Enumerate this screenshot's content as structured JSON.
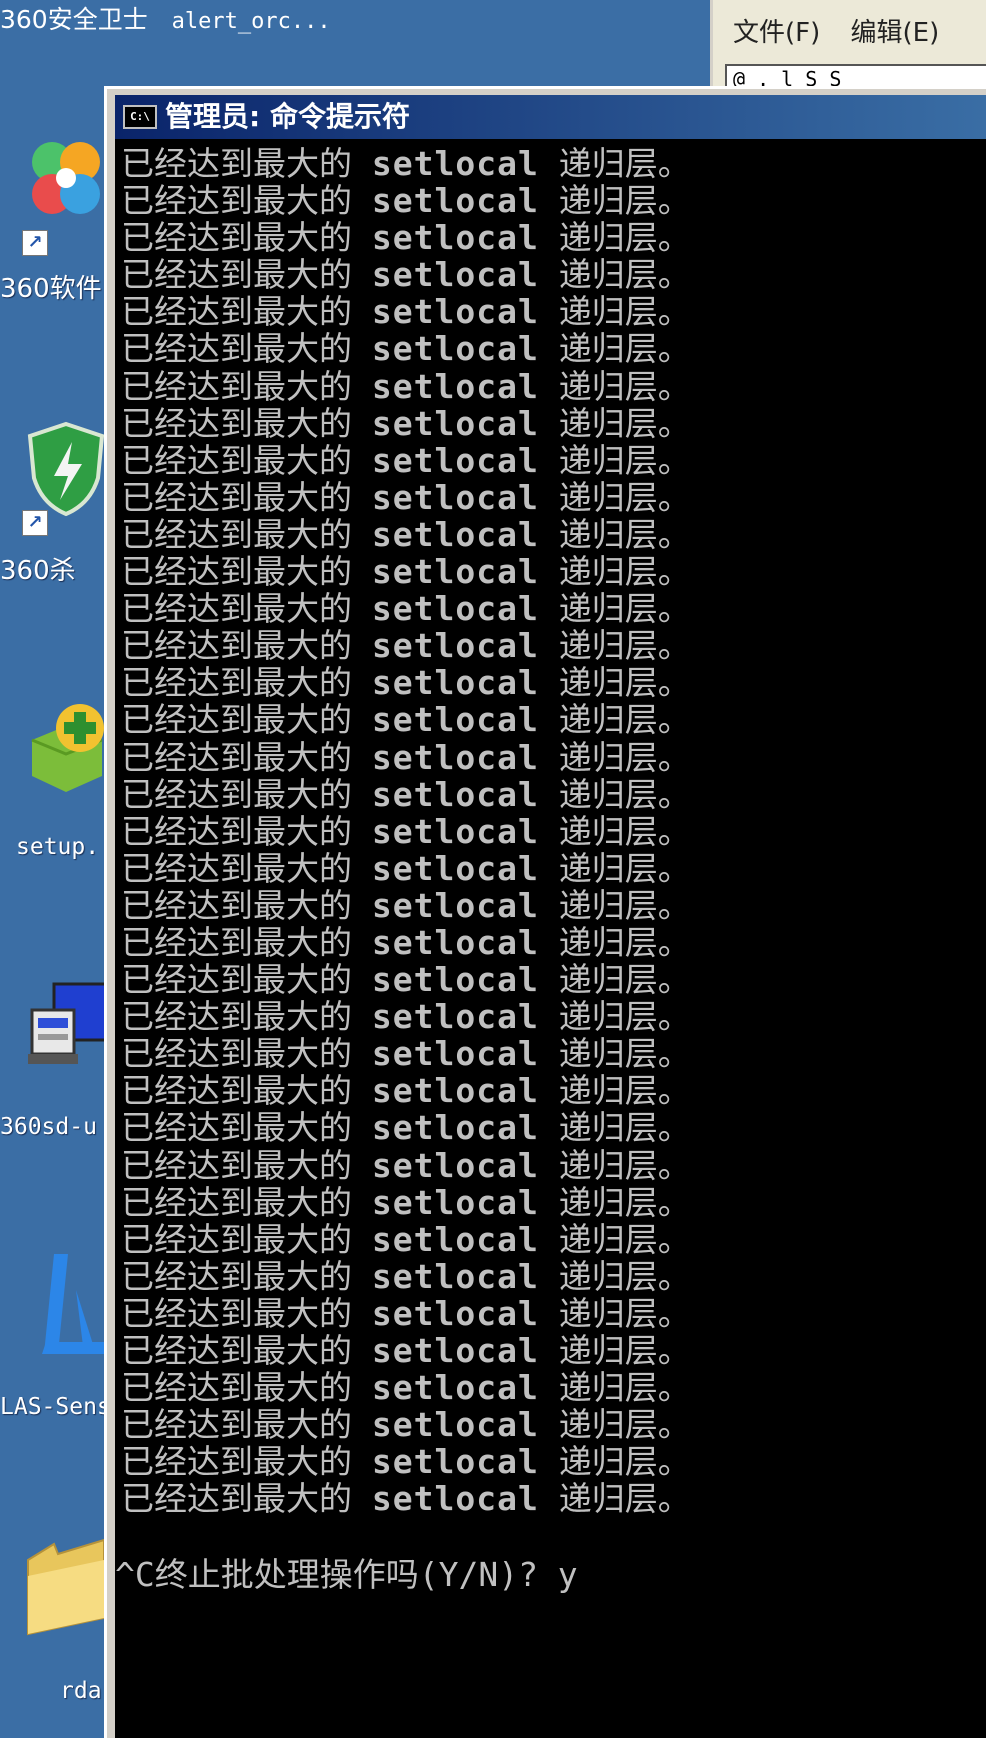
{
  "taskbar": {
    "item1": "360安全卫士",
    "item2": "alert_orc..."
  },
  "desktop_icons": [
    {
      "label": "360软件",
      "icon": "360-software-manager-icon"
    },
    {
      "label": "360杀",
      "icon": "360-antivirus-shield-icon"
    },
    {
      "label": "setup.",
      "icon": "setup-installer-icon"
    },
    {
      "label": "360sd-u",
      "icon": "360sd-upgrade-computer-icon"
    },
    {
      "label": "LAS-Sens",
      "icon": "las-logo-icon"
    },
    {
      "label": "rda",
      "icon": "folder-icon"
    }
  ],
  "background_window": {
    "menu": [
      "文件(F)",
      "编辑(E)"
    ],
    "address": "@ . l   S S"
  },
  "cmd_window": {
    "title": "管理员: 命令提示符",
    "icon_text": "C:\\",
    "line": {
      "prefix": "已经达到最大的",
      "keyword": "setlocal",
      "suffix": "递归层。"
    },
    "repeat_count": 37,
    "prompt": "^C终止批处理操作吗(Y/N)? y"
  },
  "colors": {
    "desktop": "#3b6ea5",
    "titlebar_start": "#0a246a",
    "titlebar_end": "#3a6ea5",
    "console_bg": "#000000",
    "console_text": "#c0c0c0"
  }
}
